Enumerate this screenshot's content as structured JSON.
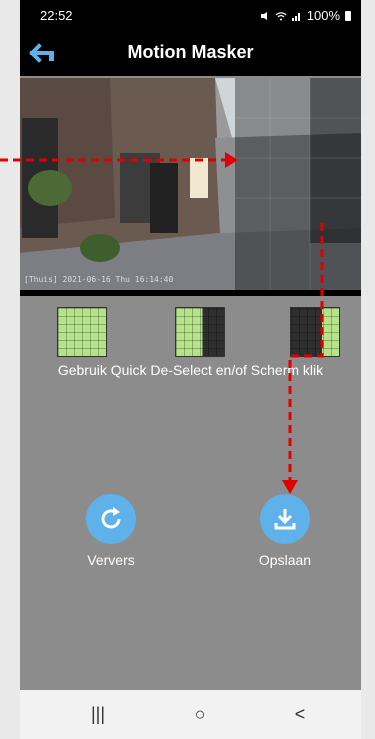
{
  "status": {
    "time": "22:52",
    "battery": "100%"
  },
  "header": {
    "title": "Motion Masker"
  },
  "camera": {
    "timestamp": "[Thuis] 2021-06-16 Thu 16:14:40"
  },
  "instruction": "Gebruik Quick De-Select en/of Scherm klik",
  "actions": {
    "refresh": "Ververs",
    "save": "Opslaan"
  },
  "navbar": {
    "recent": "|||",
    "home": "○",
    "back": "<"
  },
  "colors": {
    "accent": "#5fb1e9",
    "mask_green": "#b6e289",
    "annotation_red": "#e00000"
  }
}
